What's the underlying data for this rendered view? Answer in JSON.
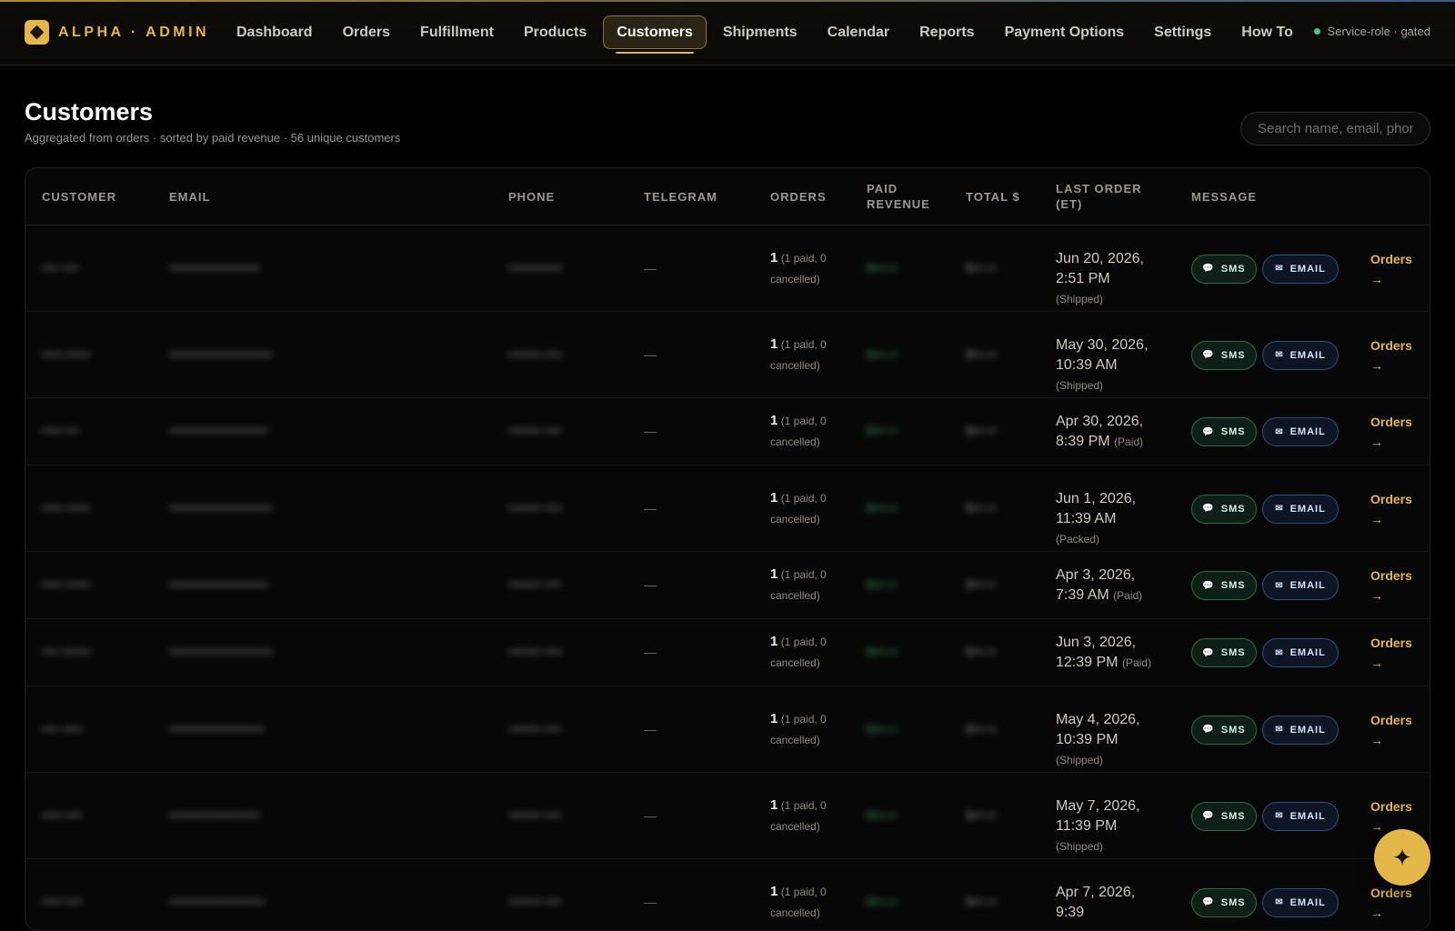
{
  "brand": {
    "name": "ALPHA · ADMIN"
  },
  "nav": {
    "items": [
      "Dashboard",
      "Orders",
      "Fulfillment",
      "Products",
      "Customers",
      "Shipments",
      "Calendar",
      "Reports",
      "Payment Options",
      "Settings",
      "How To"
    ],
    "active": "Customers"
  },
  "status": {
    "label": "Service-role · gated",
    "color": "#3fc98a"
  },
  "page": {
    "title": "Customers",
    "subtitle": "Aggregated from orders · sorted by paid revenue · 56 unique customers"
  },
  "search": {
    "placeholder": "Search name, email, phone",
    "value": ""
  },
  "table": {
    "columns": {
      "customer": "CUSTOMER",
      "email": "EMAIL",
      "phone": "PHONE",
      "telegram": "TELEGRAM",
      "orders": "ORDERS",
      "paid_revenue": "PAID REVENUE",
      "total": "TOTAL $",
      "last_order": "LAST ORDER (ET)",
      "message": "MESSAGE"
    },
    "sms_label": "SMS",
    "email_label": "EMAIL",
    "orders_link_label": "Orders",
    "orders_link_arrow": "→",
    "rows": [
      {
        "customer": "•••• ••••",
        "email": "••••••••••••••••••••••",
        "phone": "•••••••••••••",
        "telegram": "—",
        "orders_count": "1",
        "orders_detail": "(1 paid, 0 cancelled)",
        "paid": "$•••.••",
        "total": "$•••.••",
        "last_order": "Jun 20, 2026, 2:51 PM",
        "last_status": "(Shipped)"
      },
      {
        "customer": "••••• ••••••",
        "email": "•••••••••••••••••••••••••",
        "phone": "•••••••• ••••",
        "telegram": "—",
        "orders_count": "1",
        "orders_detail": "(1 paid, 0 cancelled)",
        "paid": "$•••.••",
        "total": "$•••.••",
        "last_order": "May 30, 2026, 10:39 AM",
        "last_status": "(Shipped)"
      },
      {
        "customer": "••••• •••",
        "email": "••••••••••••••••••••••••",
        "phone": "•••••••• ••••",
        "telegram": "—",
        "orders_count": "1",
        "orders_detail": "(1 paid, 0 cancelled)",
        "paid": "$•••.••",
        "total": "$•••.••",
        "last_order": "Apr 30, 2026, 8:39 PM",
        "last_status": "(Paid)"
      },
      {
        "customer": "••••• ••••••",
        "email": "•••••••••••••••••••••••••",
        "phone": "•••••••• ••••",
        "telegram": "—",
        "orders_count": "1",
        "orders_detail": "(1 paid, 0 cancelled)",
        "paid": "$•••.••",
        "total": "$•••.••",
        "last_order": "Jun 1, 2026, 11:39 AM",
        "last_status": "(Packed)"
      },
      {
        "customer": "••••• ••••••",
        "email": "••••••••••••••••••••••••",
        "phone": "•••••••• ••••",
        "telegram": "—",
        "orders_count": "1",
        "orders_detail": "(1 paid, 0 cancelled)",
        "paid": "$•••.••",
        "total": "$•••.••",
        "last_order": "Apr 3, 2026, 7:39 AM",
        "last_status": "(Paid)"
      },
      {
        "customer": "•••• •••••••",
        "email": "•••••••••••••••••••••••••",
        "phone": "•••••••• ••••",
        "telegram": "—",
        "orders_count": "1",
        "orders_detail": "(1 paid, 0 cancelled)",
        "paid": "$•••.••",
        "total": "$•••.••",
        "last_order": "Jun 3, 2026, 12:39 PM",
        "last_status": "(Paid)"
      },
      {
        "customer": "•••• •••••",
        "email": "•••••••••••••••••••••••",
        "phone": "•••••••• ••••",
        "telegram": "—",
        "orders_count": "1",
        "orders_detail": "(1 paid, 0 cancelled)",
        "paid": "$•••.••",
        "total": "$•••.••",
        "last_order": "May 4, 2026, 10:39 PM",
        "last_status": "(Shipped)"
      },
      {
        "customer": "••••• ••••",
        "email": "••••••••••••••••••••••",
        "phone": "•••••••• ••••",
        "telegram": "—",
        "orders_count": "1",
        "orders_detail": "(1 paid, 0 cancelled)",
        "paid": "$•••.••",
        "total": "$•••.••",
        "last_order": "May 7, 2026, 11:39 PM",
        "last_status": "(Shipped)"
      },
      {
        "customer": "••••• ••••",
        "email": "•••••••••••••••••••••••",
        "phone": "•••••••• ••••",
        "telegram": "—",
        "orders_count": "1",
        "orders_detail": "(1 paid, 0 cancelled)",
        "paid": "$•••.••",
        "total": "$•••.••",
        "last_order": "Apr 7, 2026, 9:39",
        "last_status": ""
      }
    ]
  },
  "fab": {
    "icon": "sparkle-icon"
  },
  "colors": {
    "accent": "#e3b74a",
    "sms": "#2a6a4a",
    "email": "#2e4e7e",
    "background": "#000000"
  }
}
